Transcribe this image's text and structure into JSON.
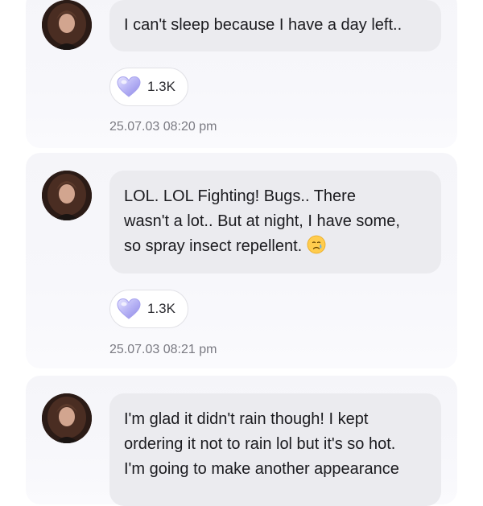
{
  "messages": [
    {
      "lines": [
        "I can't sleep because I have a day left.."
      ],
      "reaction_count": "1.3K",
      "timestamp": "25.07.03 08:20 pm"
    },
    {
      "lines": [
        "LOL. LOL Fighting! Bugs.. There",
        "wasn't a lot.. But at night, I have some,",
        "so spray insect repellent."
      ],
      "emoji": "crying-face-emoji",
      "reaction_count": "1.3K",
      "timestamp": "25.07.03 08:21 pm"
    },
    {
      "lines": [
        "I'm glad it didn't rain though! I kept",
        "ordering it not to rain lol but it's so hot.",
        "I'm going to make another appearance"
      ]
    }
  ],
  "icons": {
    "reaction": "heart-icon",
    "avatar": "avatar"
  },
  "colors": {
    "card_bg": "#f6f6fa",
    "bubble_bg": "#ebebef",
    "heart": "#b7b3f5",
    "timestamp": "#7a7a82"
  }
}
